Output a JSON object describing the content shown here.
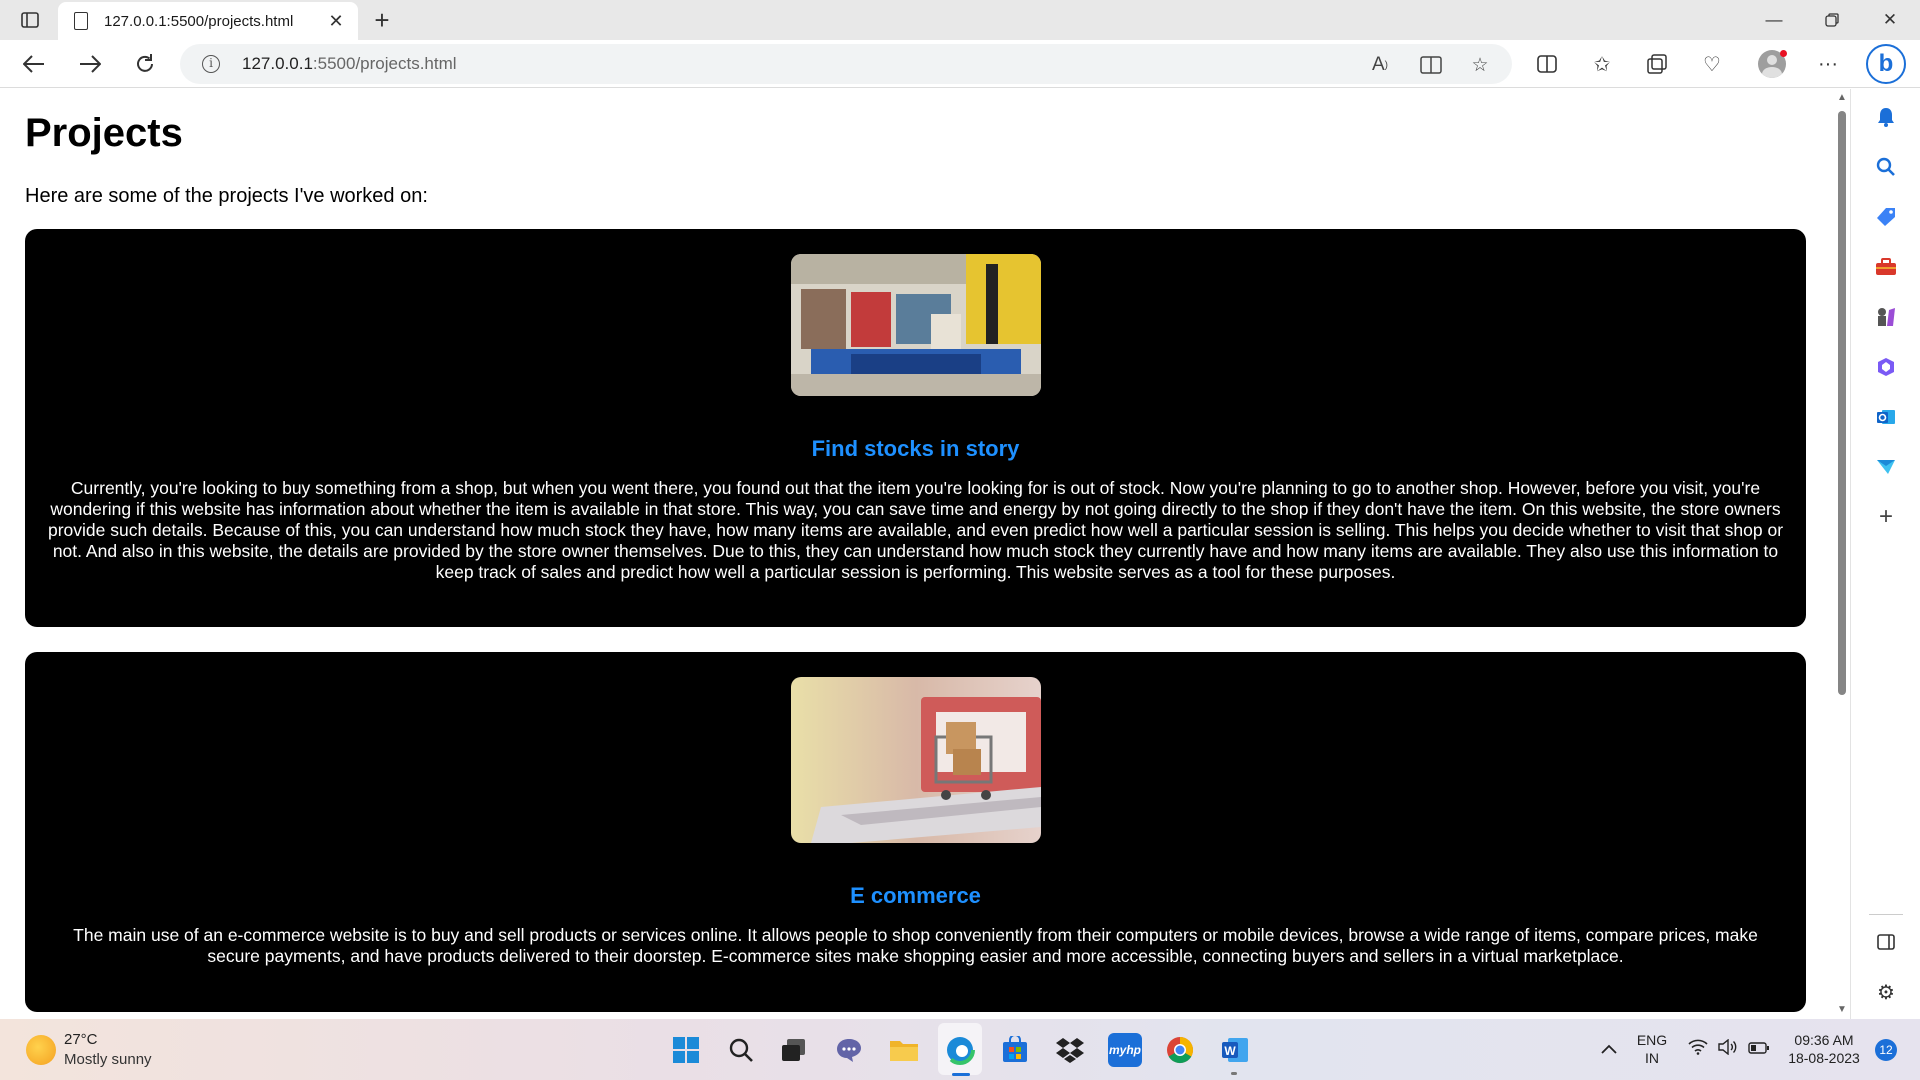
{
  "browser": {
    "tab_title": "127.0.0.1:5500/projects.html",
    "url_host": "127.0.0.1",
    "url_rest": ":5500/projects.html"
  },
  "page": {
    "title": "Projects",
    "intro": "Here are some of the projects I've worked on:",
    "projects": [
      {
        "title": "Find stocks in story",
        "description": "Currently, you're looking to buy something from a shop, but when you went there, you found out that the item you're looking for is out of stock. Now you're planning to go to another shop. However, before you visit, you're wondering if this website has information about whether the item is available in that store. This way, you can save time and energy by not going directly to the shop if they don't have the item. On this website, the store owners provide such details. Because of this, you can understand how much stock they have, how many items are available, and even predict how well a particular session is selling. This helps you decide whether to visit that shop or not. And also in this website, the details are provided by the store owner themselves. Due to this, they can understand how much stock they currently have and how many items are available. They also use this information to keep track of sales and predict how well a particular session is performing. This website serves as a tool for these purposes."
      },
      {
        "title": "E commerce",
        "description": "The main use of an e-commerce website is to buy and sell products or services online. It allows people to shop conveniently from their computers or mobile devices, browse a wide range of items, compare prices, make secure payments, and have products delivered to their doorstep. E-commerce sites make shopping easier and more accessible, connecting buyers and sellers in a virtual marketplace."
      }
    ]
  },
  "taskbar": {
    "temperature": "27°C",
    "weather": "Mostly sunny",
    "language": "ENG",
    "region": "IN",
    "time": "09:36 AM",
    "date": "18-08-2023",
    "notification_count": "12"
  },
  "colors": {
    "card_bg": "#000000",
    "card_title": "#1e90ff",
    "edge_accent": "#1b6fd8"
  }
}
